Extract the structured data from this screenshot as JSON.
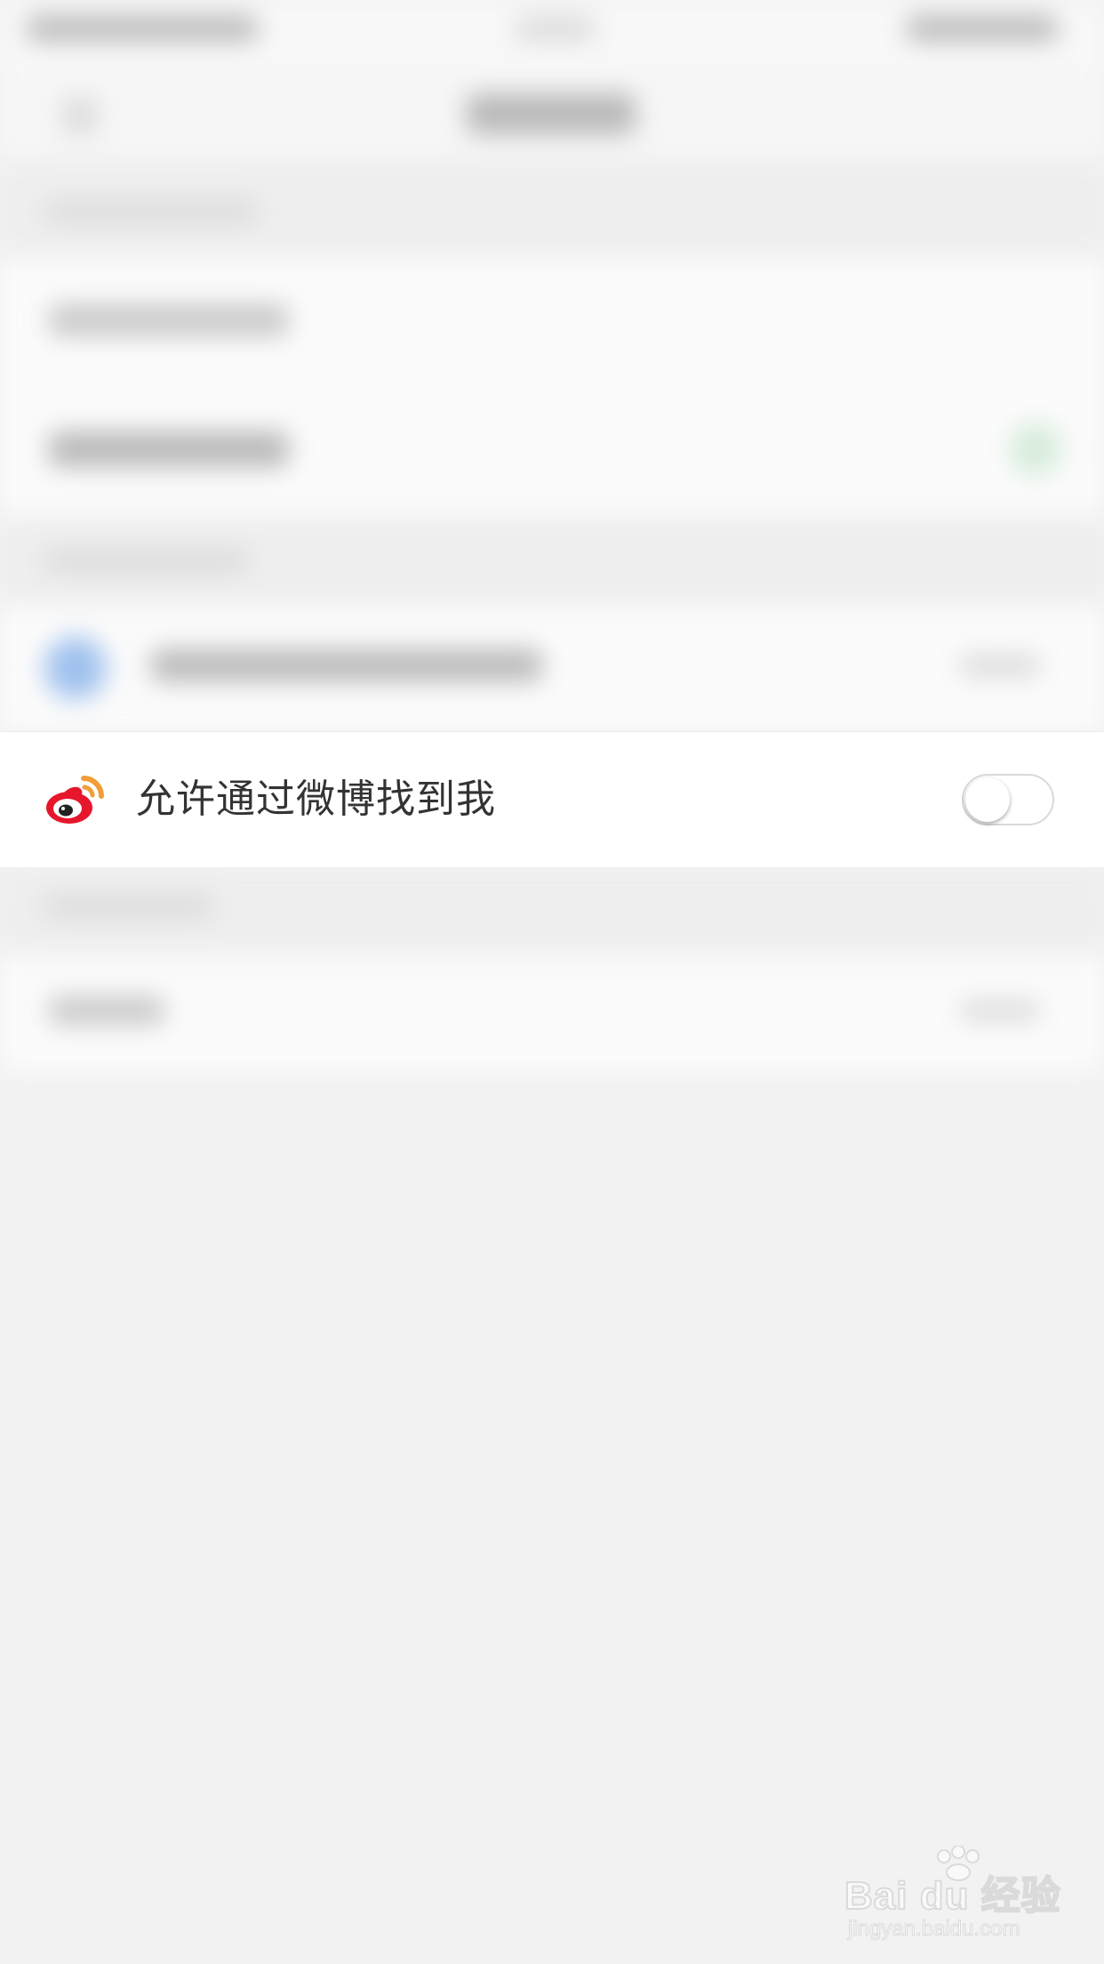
{
  "settings_row": {
    "label": "允许通过微博找到我",
    "icon": "weibo-icon",
    "toggle_on": false
  },
  "watermark": {
    "brand": "Bai du 经验",
    "url": "jingyan.baidu.com"
  },
  "colors": {
    "weibo_red": "#e6162d",
    "weibo_orange": "#f29d39",
    "background": "#f2f2f2",
    "row_background": "#ffffff",
    "label_text": "#333333"
  }
}
